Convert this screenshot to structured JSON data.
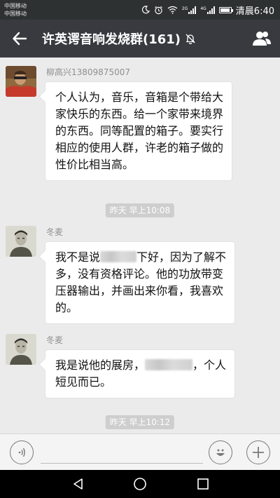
{
  "status_bar": {
    "carriers": [
      "中国移动",
      "中国移动"
    ],
    "signal1_tag": "2G",
    "signal2_tag": "4G",
    "time": "清晨6:40",
    "battery_level": 0.85
  },
  "header": {
    "title": "许英谔音响发烧群(161)",
    "back_icon": "arrow-left-icon",
    "mute_icon": "bell-muted-icon",
    "members_icon": "people-icon"
  },
  "messages": [
    {
      "sender": "柳高兴13809875007",
      "lines": [
        "个人认为，音乐，音箱是个带给大",
        "家快乐的东西。给一个家带来境界",
        "的东西。同等配置的箱子。要实行",
        "相应的使用人群，许老的箱子做的",
        "性价比相当高。"
      ]
    },
    {
      "sender": "冬麦",
      "lines": [
        "我不是说",
        "下好，因为了解不",
        "多，没有资格评论。他的功放带变",
        "压器输出，并画出来你看，我喜欢",
        "的。"
      ]
    },
    {
      "sender": "冬麦",
      "lines": [
        "我是说他的展房，",
        "，个人",
        "短见而已。"
      ]
    }
  ],
  "timestamps": [
    "昨天 早上10:08",
    "昨天 早上10:12"
  ],
  "input": {
    "value": "",
    "placeholder": "",
    "voice_icon": "voice-icon",
    "emoji_icon": "emoji-icon",
    "plus_icon": "plus-icon"
  },
  "nav": {
    "back_icon": "nav-back-icon",
    "home_icon": "nav-home-icon",
    "recents_icon": "nav-recents-icon"
  }
}
